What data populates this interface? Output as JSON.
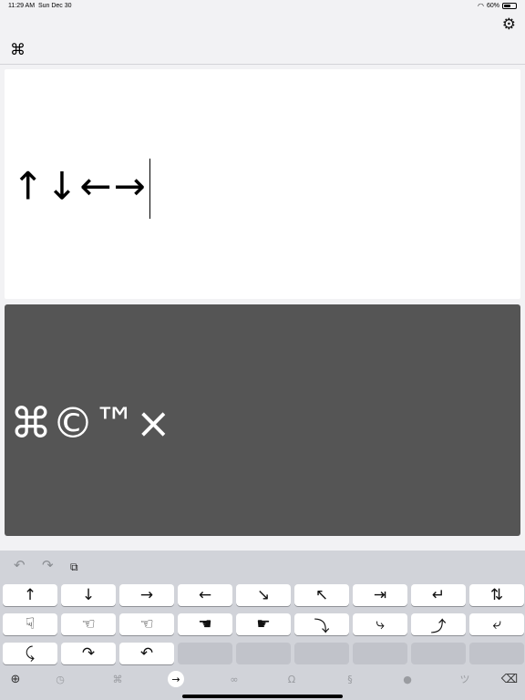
{
  "status": {
    "time": "11:29 AM",
    "date": "Sun Dec 30",
    "battery": "60%",
    "battery_level": 0.6
  },
  "nav": {
    "left_icon_glyph": "⌘",
    "settings_glyph": "⚙"
  },
  "editor": {
    "text": "↑↓←→"
  },
  "preview": {
    "text": "⌘©™×"
  },
  "toolbar": {
    "undo_glyph": "↶",
    "redo_glyph": "↷",
    "copy_glyph": "⧉"
  },
  "keys": {
    "row1": [
      "↑",
      "↓",
      "→",
      "←",
      "↘",
      "↖",
      "⇥",
      "↵",
      "⇅"
    ],
    "row2": [
      "☟",
      "☜",
      "☜",
      "☚",
      "☛",
      "⤵",
      "⤷",
      "⤴",
      "⤶"
    ],
    "row3": [
      "⤹",
      "↷",
      "↶"
    ]
  },
  "categories": [
    {
      "name": "globe-icon",
      "glyph": "⊕"
    },
    {
      "name": "clock-icon",
      "glyph": "◷"
    },
    {
      "name": "command-category",
      "glyph": "⌘"
    },
    {
      "name": "arrows-category",
      "glyph": "→"
    },
    {
      "name": "math-category",
      "glyph": "∞"
    },
    {
      "name": "greek-category",
      "glyph": "Ω"
    },
    {
      "name": "section-category",
      "glyph": "§"
    },
    {
      "name": "bullets-category",
      "glyph": "●"
    },
    {
      "name": "emoticon-category",
      "glyph": "ツ"
    },
    {
      "name": "delete-icon",
      "glyph": "⌫"
    }
  ]
}
